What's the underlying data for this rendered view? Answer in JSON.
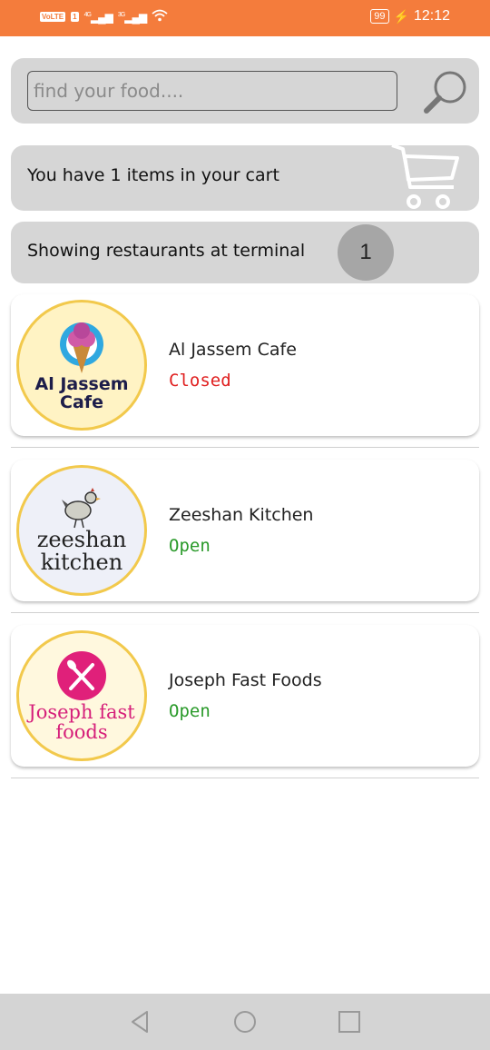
{
  "status_bar": {
    "volte": "VoLTE",
    "sim": "1",
    "signal1": "4G",
    "signal2": "3G",
    "battery": "99",
    "time": "12:12"
  },
  "search": {
    "placeholder": "find your food...."
  },
  "cart": {
    "text": "You have 1 items in your cart"
  },
  "terminal": {
    "text": "Showing restaurants at terminal",
    "number": "1"
  },
  "restaurants": [
    {
      "name": "Al Jassem Cafe",
      "status": "Closed",
      "logo_line1": "Al Jassem",
      "logo_line2": "Cafe"
    },
    {
      "name": "Zeeshan Kitchen",
      "status": "Open",
      "logo_line1": "zeeshan",
      "logo_line2": "kitchen"
    },
    {
      "name": "Joseph Fast Foods",
      "status": "Open",
      "logo_line1": "Joseph fast",
      "logo_line2": "foods"
    }
  ],
  "colors": {
    "status_bar": "#f47c3c",
    "panel": "#d6d6d6",
    "closed": "#e02020",
    "open": "#2a9a2a",
    "logo_border": "#f2c94c"
  }
}
